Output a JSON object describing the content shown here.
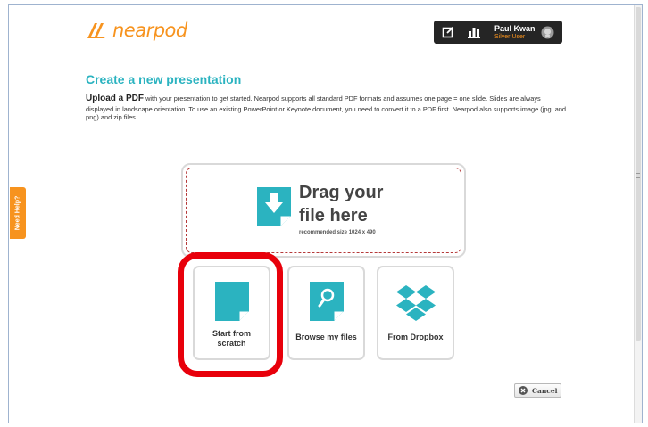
{
  "app": {
    "logo_text": "nearpod",
    "brand_color": "#f7931e",
    "accent_color": "#2bb3c0"
  },
  "user": {
    "name": "Paul Kwan",
    "level": "Silver User",
    "icons": [
      "edit-icon",
      "stats-icon",
      "avatar-badge-icon"
    ]
  },
  "main": {
    "title": "Create a new presentation",
    "intro_strong": "Upload a PDF",
    "intro_rest": " with your presentation to get started. Nearpod supports all standard PDF formats and assumes one page = one slide. Slides are always displayed in landscape orientation. To use an existing PowerPoint or Keynote document, you need to convert it to a PDF first. Nearpod also supports image (jpg, and png) and zip files ."
  },
  "help": {
    "label": "Need Help?"
  },
  "dropzone": {
    "line1": "Drag your",
    "line2": "file here",
    "note": "recommended size 1024 x 490",
    "icon": "download-file-icon"
  },
  "options": [
    {
      "label_line1": "Start from",
      "label_line2": "scratch",
      "icon": "blank-page-icon"
    },
    {
      "label": "Browse my files",
      "icon": "search-file-icon"
    },
    {
      "label": "From Dropbox",
      "icon": "dropbox-icon"
    }
  ],
  "annotation": {
    "highlight_color": "#e8000b"
  },
  "footer": {
    "cancel_label": "Cancel",
    "cancel_icon": "close-circle-icon"
  }
}
